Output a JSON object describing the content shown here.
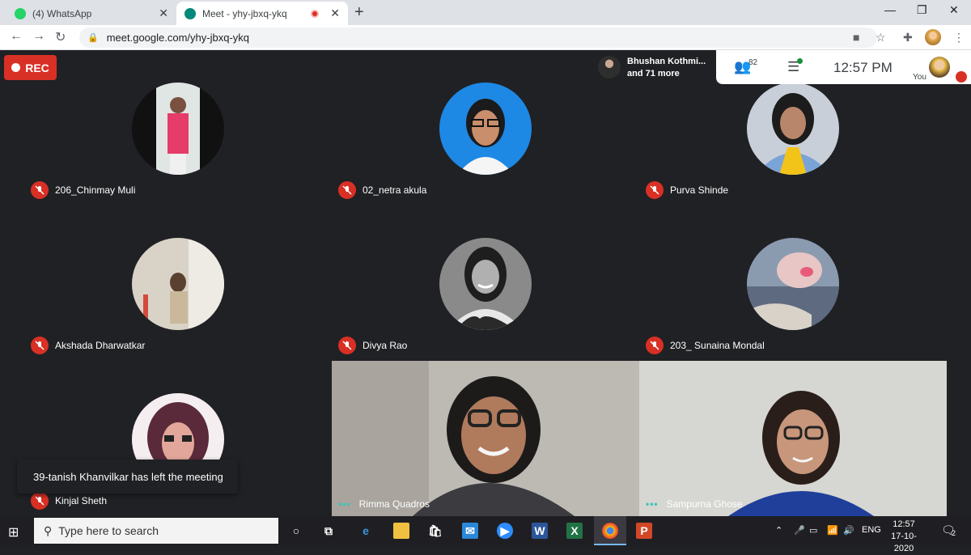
{
  "browser": {
    "tabs": [
      {
        "title": "(4) WhatsApp",
        "favicon_color": "#25d366",
        "active": false
      },
      {
        "title": "Meet - yhy-jbxq-ykq",
        "favicon_color": "#00897b",
        "active": true,
        "recording": true
      }
    ],
    "new_tab_label": "+",
    "window_controls": [
      "—",
      "❐",
      "✕"
    ],
    "url": "meet.google.com/yhy-jbxq-ykq"
  },
  "meet": {
    "rec_label": "REC",
    "people_card": {
      "line1": "Bhushan Kothmi...",
      "line2": "and 71 more"
    },
    "participants_count": "82",
    "clock": "12:57 PM",
    "self_label": "You",
    "toast": "39-tanish Khanvilkar has left the meeting",
    "tiles": [
      {
        "name": "206_Chinmay Muli",
        "muted": true,
        "avatar_bg": "#1a1a1a"
      },
      {
        "name": "02_netra akula",
        "muted": true,
        "avatar_bg": "#1e88e5"
      },
      {
        "name": "Purva Shinde",
        "muted": true,
        "avatar_bg": "#c9cfd9"
      },
      {
        "name": "Akshada Dharwatkar",
        "muted": true,
        "avatar_bg": "#d9d3c7"
      },
      {
        "name": "Divya Rao",
        "muted": true,
        "avatar_bg": "#8a8a8a"
      },
      {
        "name": "203_ Sunaina Mondal",
        "muted": true,
        "avatar_bg": "#8a9bb0"
      },
      {
        "name": "Kinjal Sheth",
        "muted": true,
        "avatar_bg": "#b04a6a"
      }
    ],
    "video_tiles": [
      {
        "name": "Rimma Quadros",
        "speaking": true
      },
      {
        "name": "Sampurna Ghose",
        "speaking": true
      }
    ]
  },
  "taskbar": {
    "search_placeholder": "Type here to search",
    "language": "ENG",
    "time": "12:57",
    "date": "17-10-2020",
    "notification_count": "2"
  }
}
